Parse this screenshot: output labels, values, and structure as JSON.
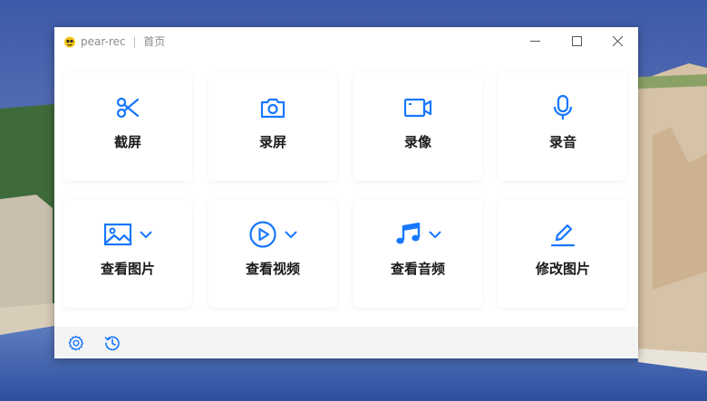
{
  "window": {
    "app_name": "pear-rec",
    "separator": "|",
    "page_name": "首页"
  },
  "features": [
    {
      "label": "截屏",
      "icon": "scissors-icon",
      "has_dropdown": false
    },
    {
      "label": "录屏",
      "icon": "camera-icon",
      "has_dropdown": false
    },
    {
      "label": "录像",
      "icon": "video-camera-icon",
      "has_dropdown": false
    },
    {
      "label": "录音",
      "icon": "microphone-icon",
      "has_dropdown": false
    },
    {
      "label": "查看图片",
      "icon": "image-icon",
      "has_dropdown": true
    },
    {
      "label": "查看视频",
      "icon": "play-circle-icon",
      "has_dropdown": true
    },
    {
      "label": "查看音频",
      "icon": "music-note-icon",
      "has_dropdown": true
    },
    {
      "label": "修改图片",
      "icon": "edit-pen-icon",
      "has_dropdown": false
    }
  ],
  "footer": {
    "icons": [
      "settings-icon",
      "history-icon"
    ]
  },
  "colors": {
    "accent": "#1677ff",
    "label": "#1a1a1a",
    "footer_bg": "#f4f4f4"
  }
}
